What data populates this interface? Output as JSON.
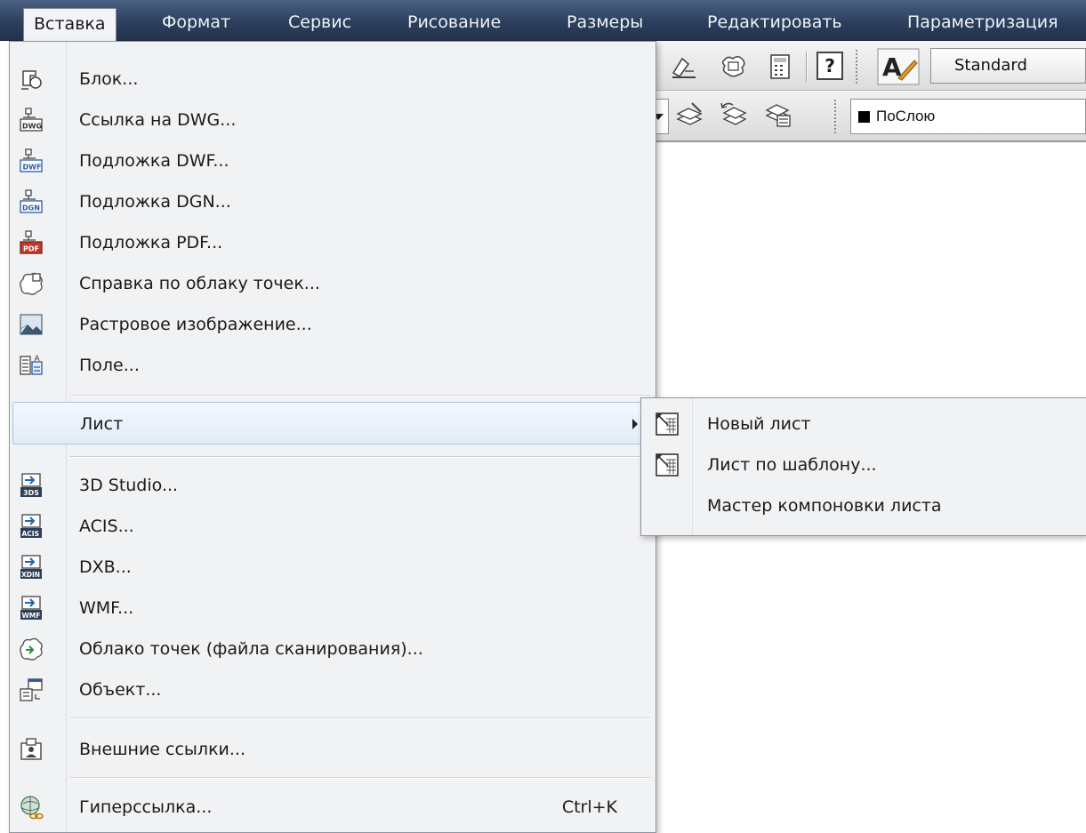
{
  "menubar": {
    "items": [
      {
        "label": "Вставка",
        "active": true
      },
      {
        "label": "Формат"
      },
      {
        "label": "Сервис"
      },
      {
        "label": "Рисование"
      },
      {
        "label": "Размеры"
      },
      {
        "label": "Редактировать"
      },
      {
        "label": "Параметризация"
      }
    ]
  },
  "toolbar": {
    "text_style_value": "Standard",
    "layer_value": "ПоСлою",
    "help_label": "?"
  },
  "insert_menu": {
    "items": [
      {
        "label": "Блок...",
        "icon": "block-icon"
      },
      {
        "label": "Ссылка на DWG...",
        "icon": "dwg-icon",
        "badge": "DWG"
      },
      {
        "label": "Подложка DWF...",
        "icon": "dwf-icon",
        "badge": "DWF"
      },
      {
        "label": "Подложка DGN...",
        "icon": "dgn-icon",
        "badge": "DGN"
      },
      {
        "label": "Подложка PDF...",
        "icon": "pdf-icon",
        "badge": "PDF"
      },
      {
        "label": "Справка по облаку точек...",
        "icon": "point-cloud-icon"
      },
      {
        "label": "Растровое изображение...",
        "icon": "raster-image-icon"
      },
      {
        "label": "Поле...",
        "icon": "field-icon"
      },
      {
        "label": "Лист",
        "icon": "",
        "submenu": true
      },
      {
        "label": "3D Studio...",
        "icon": "3ds-import-icon",
        "badge": "3DS"
      },
      {
        "label": "ACIS...",
        "icon": "acis-import-icon",
        "badge": "ACIS"
      },
      {
        "label": "DXB...",
        "icon": "dxb-import-icon",
        "badge": "XDIN"
      },
      {
        "label": "WMF...",
        "icon": "wmf-import-icon",
        "badge": "WMF"
      },
      {
        "label": "Облако точек (файла сканирования)...",
        "icon": "scan-cloud-icon"
      },
      {
        "label": "Объект...",
        "icon": "ole-object-icon"
      },
      {
        "label": "Внешние ссылки...",
        "icon": "xref-icon"
      },
      {
        "label": "Гиперссылка...",
        "icon": "hyperlink-icon",
        "shortcut": "Ctrl+K"
      }
    ]
  },
  "layout_submenu": {
    "items": [
      {
        "label": "Новый лист",
        "icon": "new-layout-icon"
      },
      {
        "label": "Лист по шаблону...",
        "icon": "layout-template-icon"
      },
      {
        "label": "Мастер компоновки листа",
        "icon": ""
      }
    ]
  },
  "colors": {
    "menubar": "#2c3f5d",
    "highlight_border": "#a7c4e4",
    "menu_bg": "#f1f2f4",
    "pdf_red": "#c0392b",
    "import_blue": "#1f66b5"
  }
}
